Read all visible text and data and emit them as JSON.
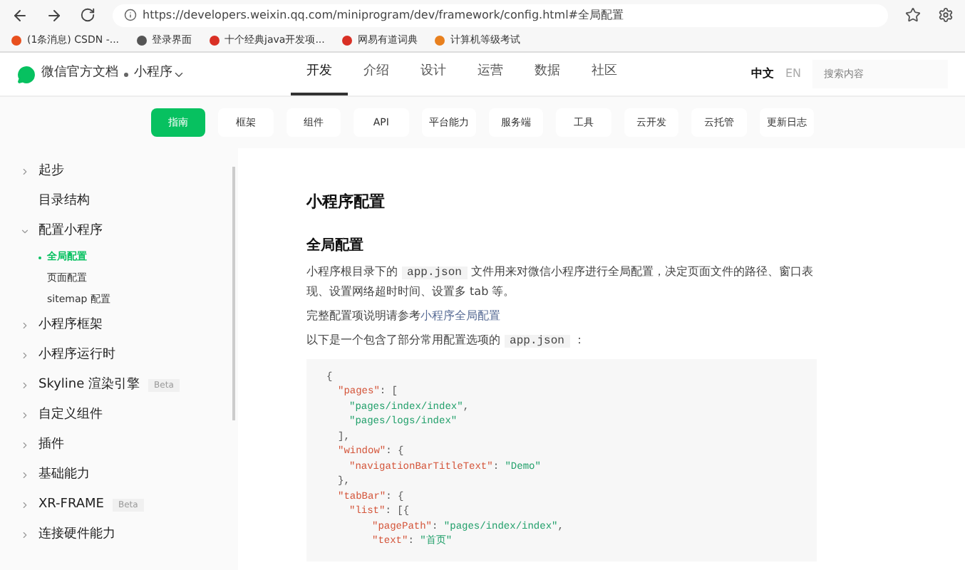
{
  "browser": {
    "url": "https://developers.weixin.qq.com/miniprogram/dev/framework/config.html#全局配置",
    "bookmarks": [
      {
        "label": "(1条消息) CSDN -...",
        "color": "#e8501e"
      },
      {
        "label": "登录界面",
        "color": "#555555"
      },
      {
        "label": "十个经典java开发项...",
        "color": "#d93025"
      },
      {
        "label": "网易有道词典",
        "color": "#d93025"
      },
      {
        "label": "计算机等级考试",
        "color": "#e8801e"
      }
    ]
  },
  "header": {
    "brand": "微信官方文档",
    "product": "小程序",
    "nav": [
      {
        "label": "开发",
        "selected": true
      },
      {
        "label": "介绍",
        "selected": false
      },
      {
        "label": "设计",
        "selected": false
      },
      {
        "label": "运营",
        "selected": false
      },
      {
        "label": "数据",
        "selected": false
      },
      {
        "label": "社区",
        "selected": false
      }
    ],
    "languages": [
      {
        "label": "中文",
        "selected": true
      },
      {
        "label": "EN",
        "selected": false
      }
    ],
    "search": {
      "placeholder": "搜索内容"
    }
  },
  "subnav": [
    {
      "label": "指南",
      "selected": true
    },
    {
      "label": "框架",
      "selected": false
    },
    {
      "label": "组件",
      "selected": false
    },
    {
      "label": "API",
      "selected": false
    },
    {
      "label": "平台能力",
      "selected": false
    },
    {
      "label": "服务端",
      "selected": false
    },
    {
      "label": "工具",
      "selected": false
    },
    {
      "label": "云开发",
      "selected": false
    },
    {
      "label": "云托管",
      "selected": false
    },
    {
      "label": "更新日志",
      "selected": false
    }
  ],
  "sidebar": [
    {
      "kind": "group",
      "label": "起步",
      "expanded": false
    },
    {
      "kind": "link",
      "label": "目录结构"
    },
    {
      "kind": "group",
      "label": "配置小程序",
      "expanded": true,
      "children": [
        {
          "label": "全局配置",
          "selected": true
        },
        {
          "label": "页面配置",
          "selected": false
        },
        {
          "label": "sitemap 配置",
          "selected": false
        }
      ]
    },
    {
      "kind": "group",
      "label": "小程序框架",
      "expanded": false
    },
    {
      "kind": "group",
      "label": "小程序运行时",
      "expanded": false
    },
    {
      "kind": "group",
      "label": "Skyline 渲染引擎",
      "expanded": false,
      "badge": "Beta"
    },
    {
      "kind": "group",
      "label": "自定义组件",
      "expanded": false
    },
    {
      "kind": "group",
      "label": "插件",
      "expanded": false
    },
    {
      "kind": "group",
      "label": "基础能力",
      "expanded": false
    },
    {
      "kind": "group",
      "label": "XR-FRAME",
      "expanded": false,
      "badge": "Beta"
    },
    {
      "kind": "group",
      "label": "连接硬件能力",
      "expanded": false
    }
  ],
  "article": {
    "title": "小程序配置",
    "section": "全局配置",
    "paragraphs": [
      [
        {
          "kind": "text",
          "text": "小程序根目录下的 "
        },
        {
          "kind": "code",
          "text": "app.json"
        },
        {
          "kind": "text",
          "text": " 文件用来对微信小程序进行全局配置，决定页面文件的路径、窗口表现、设置网络超时时间、设置多 tab 等。"
        }
      ],
      [
        {
          "kind": "text",
          "text": "完整配置项说明请参考"
        },
        {
          "kind": "link",
          "text": "小程序全局配置"
        }
      ],
      [
        {
          "kind": "text",
          "text": "以下是一个包含了部分常用配置选项的 "
        },
        {
          "kind": "code",
          "text": "app.json"
        },
        {
          "kind": "text",
          "text": " ："
        }
      ]
    ],
    "code": [
      [
        {
          "kind": "punct",
          "text": "{"
        }
      ],
      [
        {
          "kind": "key",
          "text": "\"pages\""
        },
        {
          "kind": "punct",
          "text": ": ["
        }
      ],
      [
        {
          "kind": "string",
          "text": "\"pages/index/index\""
        },
        {
          "kind": "punct",
          "text": ","
        }
      ],
      [
        {
          "kind": "string",
          "text": "\"pages/logs/index\""
        }
      ],
      [
        {
          "kind": "punct",
          "text": "],"
        }
      ],
      [
        {
          "kind": "key",
          "text": "\"window\""
        },
        {
          "kind": "punct",
          "text": ": {"
        }
      ],
      [
        {
          "kind": "key",
          "text": "\"navigationBarTitleText\""
        },
        {
          "kind": "punct",
          "text": ": "
        },
        {
          "kind": "string",
          "text": "\"Demo\""
        }
      ],
      [
        {
          "kind": "punct",
          "text": "},"
        }
      ],
      [
        {
          "kind": "key",
          "text": "\"tabBar\""
        },
        {
          "kind": "punct",
          "text": ": {"
        }
      ],
      [
        {
          "kind": "key",
          "text": "\"list\""
        },
        {
          "kind": "punct",
          "text": ": [{"
        }
      ],
      [
        {
          "kind": "key",
          "text": "\"pagePath\""
        },
        {
          "kind": "punct",
          "text": ": "
        },
        {
          "kind": "string",
          "text": "\"pages/index/index\""
        },
        {
          "kind": "punct",
          "text": ","
        }
      ],
      [
        {
          "kind": "key",
          "text": "\"text\""
        },
        {
          "kind": "punct",
          "text": ": "
        },
        {
          "kind": "string",
          "text": "\"首页\""
        }
      ]
    ]
  }
}
